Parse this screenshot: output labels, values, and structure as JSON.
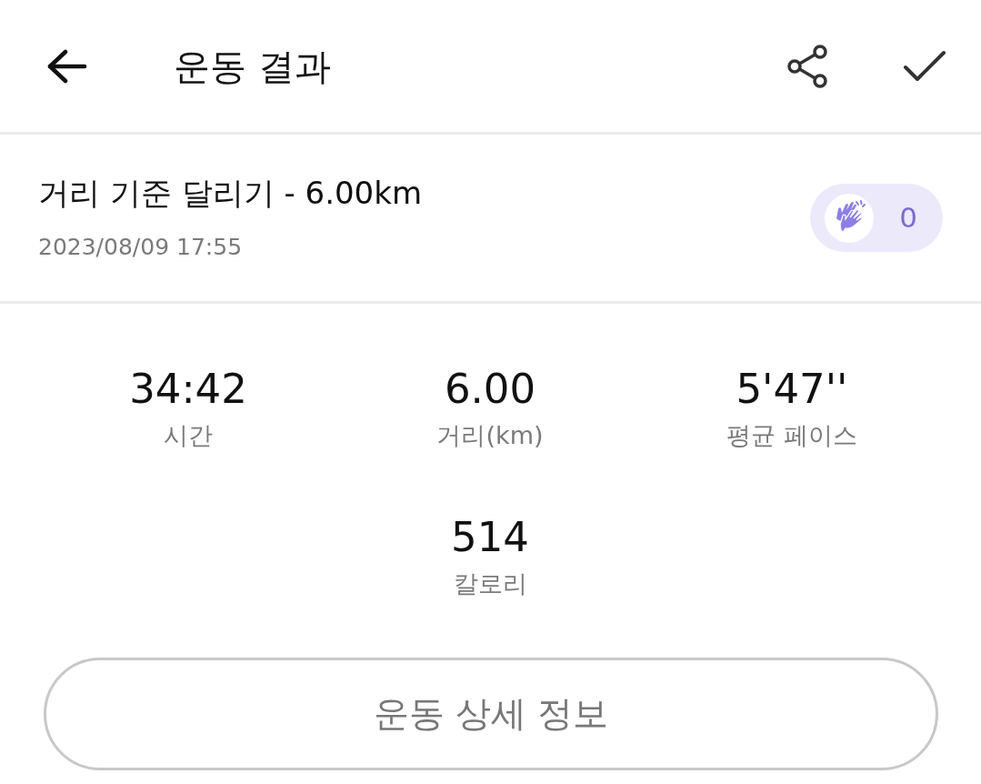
{
  "header": {
    "title": "운동 결과",
    "actions": [
      {
        "kind": "share"
      },
      {
        "kind": "confirm"
      }
    ]
  },
  "workout": {
    "title": "거리 기준 달리기 - 6.00km",
    "date": "2023/08/09 17:55",
    "claps": "0"
  },
  "stats": [
    {
      "value": "34:42",
      "label": "시간"
    },
    {
      "value": "6.00",
      "label": "거리(km)"
    },
    {
      "value": "5'47''",
      "label": "평균 페이스"
    },
    {
      "value": "514",
      "label": "칼로리"
    }
  ],
  "detail_button": {
    "label": "운동 상세 정보"
  }
}
